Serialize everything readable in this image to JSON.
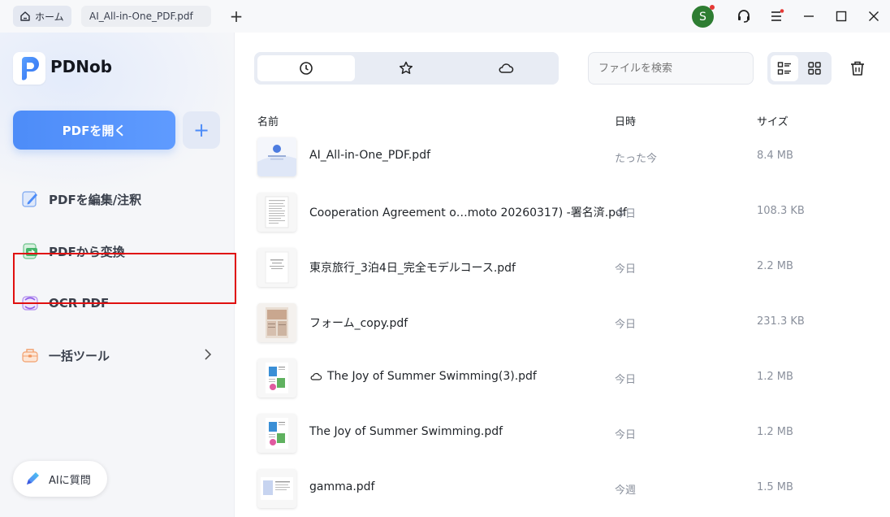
{
  "topbar": {
    "home_tab": "ホーム",
    "file_tab": "AI_All-in-One_PDF.pdf",
    "new_tab_label": "+",
    "avatar_initial": "S"
  },
  "sidebar": {
    "brand": "PDNob",
    "open_button": "PDFを開く",
    "add_button": "+",
    "items": [
      {
        "label": "PDFを編集/注釈",
        "icon": "edit-icon"
      },
      {
        "label": "PDFから変換",
        "icon": "convert-icon"
      },
      {
        "label": "OCR PDF",
        "icon": "ocr-icon"
      },
      {
        "label": "一括ツール",
        "icon": "toolbox-icon"
      }
    ],
    "ai_button": "AIに質問"
  },
  "main": {
    "search_placeholder": "ファイルを検索",
    "columns": {
      "name": "名前",
      "date": "日時",
      "size": "サイズ"
    },
    "files": [
      {
        "name": "AI_All-in-One_PDF.pdf",
        "date": "たった今",
        "size": "8.4 MB",
        "cloud": false
      },
      {
        "name": "Cooperation Agreement o…moto 20260317) -署名済.pdf",
        "date": "今日",
        "size": "108.3 KB",
        "cloud": false
      },
      {
        "name": "東京旅行_3泊4日_完全モデルコース.pdf",
        "date": "今日",
        "size": "2.2 MB",
        "cloud": false
      },
      {
        "name": "フォーム_copy.pdf",
        "date": "今日",
        "size": "231.3 KB",
        "cloud": false
      },
      {
        "name": "The Joy of Summer Swimming(3).pdf",
        "date": "今日",
        "size": "1.2 MB",
        "cloud": true
      },
      {
        "name": "The Joy of Summer Swimming.pdf",
        "date": "今日",
        "size": "1.2 MB",
        "cloud": false
      },
      {
        "name": "gamma.pdf",
        "date": "今週",
        "size": "1.5 MB",
        "cloud": false
      }
    ]
  },
  "colors": {
    "accent": "#4d8cf8",
    "highlight_border": "#e01010",
    "avatar_bg": "#2e7d32"
  }
}
